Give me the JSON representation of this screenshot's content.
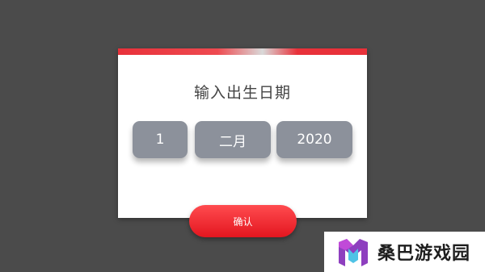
{
  "dialog": {
    "title": "输入出生日期",
    "day": "1",
    "month": "二月",
    "year": "2020",
    "confirm_label": "确认"
  },
  "watermark": {
    "text": "桑巴游戏园"
  },
  "colors": {
    "background": "#4b4b4b",
    "accent_red": "#e8313a",
    "picker_gray": "#8c919b"
  }
}
